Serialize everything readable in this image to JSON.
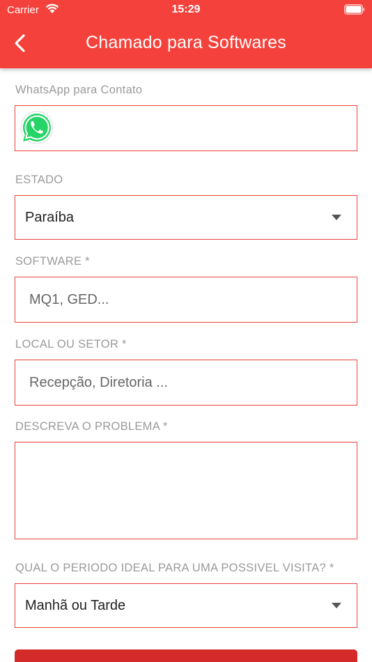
{
  "status_bar": {
    "carrier": "Carrier",
    "time": "15:29"
  },
  "header": {
    "title": "Chamado para Softwares"
  },
  "colors": {
    "accent": "#f5413b",
    "border": "#e8413b",
    "button": "#d42a2a"
  },
  "form": {
    "whatsapp": {
      "label": "WhatsApp para Contato",
      "value": ""
    },
    "estado": {
      "label": "ESTADO",
      "selected": "Paraíba"
    },
    "software": {
      "label": "SOFTWARE *",
      "placeholder": "MQ1, GED..."
    },
    "local": {
      "label": "LOCAL OU SETOR *",
      "placeholder": "Recepção, Diretoria ..."
    },
    "problema": {
      "label": "DESCREVA O PROBLEMA *",
      "value": ""
    },
    "periodo": {
      "label": "QUAL O PERIODO IDEAL PARA UMA POSSIVEL VISITA? *",
      "selected": "Manhã ou Tarde"
    }
  }
}
